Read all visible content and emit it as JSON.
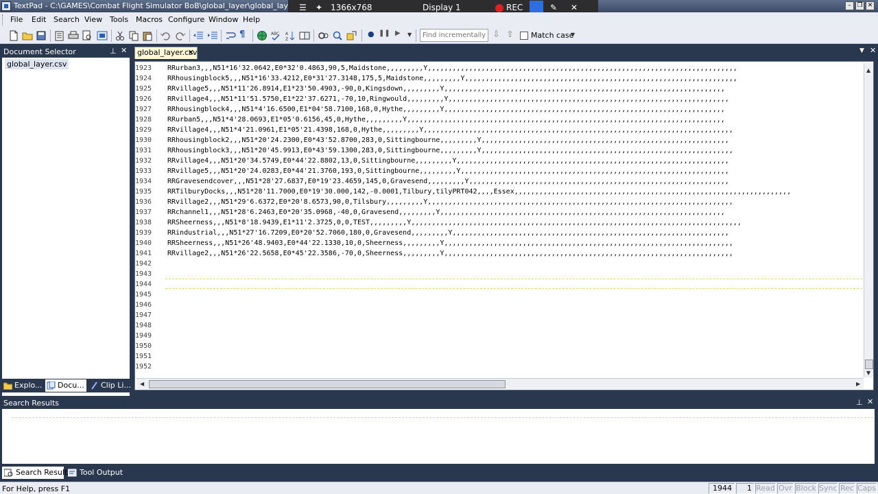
{
  "window": {
    "title": "TextPad - C:\\GAMES\\Combat Flight Simulator BoB\\global_layer\\global_layer.csv"
  },
  "recorder": {
    "resolution": "1366x768",
    "display": "Display 1",
    "rec_label": "REC"
  },
  "menu": [
    "File",
    "Edit",
    "Search",
    "View",
    "Tools",
    "Macros",
    "Configure",
    "Window",
    "Help"
  ],
  "toolbar": {
    "find_placeholder": "Find incrementally",
    "match_case_label": "Match case",
    "match_case_checked": false
  },
  "doc_selector": {
    "title": "Document Selector",
    "files": [
      "global_layer.csv"
    ],
    "tabs": [
      "Explo...",
      "Docu...",
      "Clip Li..."
    ],
    "active_tab": "Docu..."
  },
  "editor": {
    "tab_label": "global_layer.csv",
    "lines": [
      {
        "n": "1923",
        "text": "RRurban3,,,N51*16'32.0642,E0*32'0.4863,90,5,Maidstone,,,,,,,,,Y,,,,,,,,,,,,,,,,,,,,,,,,,,,,,,,,,,,,,,,,,,,,,,,,,,,,,,,,,,,,,,,,,,,,,,,,,,,"
      },
      {
        "n": "1924",
        "text": "RRhousingblock5,,,N51*16'33.4212,E0*31'27.3148,175,5,Maidstone,,,,,,,,,Y,,,,,,,,,,,,,,,,,,,,,,,,,,,,,,,,,,,,,,,,,,,,,,,,,,,,,,,,,,,,,,,,,,"
      },
      {
        "n": "1925",
        "text": "RRvillage5,,,N51*11'26.8914,E1*23'50.4903,-90,0,Kingsdown,,,,,,,,,Y,,,,,,,,,,,,,,,,,,,,,,,,,,,,,,,,,,,,,,,,,,,,,,,,,,,,,,,,,,,,,,,,,,,,"
      },
      {
        "n": "1926",
        "text": "RRvillage4,,,N51*11'51.5750,E1*22'37.6271,-70,10,Ringwould,,,,,,,,,Y,,,,,,,,,,,,,,,,,,,,,,,,,,,,,,,,,,,,,,,,,,,,,,,,,,,,,,,,,,,,,,,,,,,,"
      },
      {
        "n": "1927",
        "text": "RRhousingblock4,,,N51*4'16.6500,E1*04'58.7100,168,0,Hythe,,,,,,,,,Y,,,,,,,,,,,,,,,,,,,,,,,,,,,,,,,,,,,,,,,,,,,,,,,,,,,,,,,,,,,,,,,,,,,,"
      },
      {
        "n": "1928",
        "text": "RRurban5,,,N51*4'28.0693,E1*05'0.6156,45,0,Hythe,,,,,,,,,Y,,,,,,,,,,,,,,,,,,,,,,,,,,,,,,,,,,,,,,,,,,,,,,,,,,,,,,,,,,,,,,,,,,,,,,,,,,,,,"
      },
      {
        "n": "1929",
        "text": "RRvillage4,,,N51*4'21.0961,E1*05'21.4398,168,0,Hythe,,,,,,,,,Y,,,,,,,,,,,,,,,,,,,,,,,,,,,,,,,,,,,,,,,,,,,,,,,,,,,,,,,,,,,,,,,,,,,,,,,,,,,"
      },
      {
        "n": "1930",
        "text": "RRhousingblock2,,,N51*20'24.2300,E0*43'52.8700,283,0,Sittingbourne,,,,,,,,,Y,,,,,,,,,,,,,,,,,,,,,,,,,,,,,,,,,,,,,,,,,,,,,,,,,,,,,,,,,,,,"
      },
      {
        "n": "1931",
        "text": "RRhousingblock3,,,N51*20'45.9913,E0*43'59.1300,283,0,Sittingbourne,,,,,,,,,Y,,,,,,,,,,,,,,,,,,,,,,,,,,,,,,,,,,,,,,,,,,,,,,,,,,,,,,,,,,,,,"
      },
      {
        "n": "1932",
        "text": "RRvillage4,,,N51*20'34.5749,E0*44'22.8802,13,0,Sittingbourne,,,,,,,,,Y,,,,,,,,,,,,,,,,,,,,,,,,,,,,,,,,,,,,,,,,,,,,,,,,,,,,,,,,,,,,,,,,,,"
      },
      {
        "n": "1933",
        "text": "RRvillage5,,,N51*20'24.0283,E0*44'21.3760,193,0,Sittingbourne,,,,,,,,,Y,,,,,,,,,,,,,,,,,,,,,,,,,,,,,,,,,,,,,,,,,,,,,,,,,,,,,,,,,,,,,,,,,"
      },
      {
        "n": "1934",
        "text": "RRGravesendcover,,,N51*28'27.6837,E0*19'23.4659,145,0,Gravesend,,,,,,,,,Y,,,,,,,,,,,,,,,,,,,,,,,,,,,,,,,,,,,,,,,,,,,,,,,,,,,,,,,,,,,,,,,"
      },
      {
        "n": "1935",
        "text": "RRTilburyDocks,,,N51*28'11.7000,E0*19'30.000,142,-0.0001,Tilbury,tilyPRT042,,,,Essex,,,,,,,,,,,,,,,,,,,,,,,,,,,,,,,,,,,,,,,,,,,,,,,,,,,,,,,,,,,,,,,,,,,"
      },
      {
        "n": "1936",
        "text": "RRvillage2,,,N51*29'6.6372,E0*20'8.6573,90,0,Tilsbury,,,,,,,,,Y,,,,,,,,,,,,,,,,,,,,,,,,,,,,,,,,,,,,,,,,,,,,,,,,,,,,,,,,,,,,,,,,,,,,,,,,,,"
      },
      {
        "n": "1937",
        "text": "RRchannel1,,,N51*28'6.2463,E0*20'35.0968,-40,0,Gravesend,,,,,,,,,Y,,,,,,,,,,,,,,,,,,,,,,,,,,,,,,,,,,,,,,,,,,,,,,,,,,,,,,,,,,,,,,,,,,,,,"
      },
      {
        "n": "1938",
        "text": "RRSheerness,,,N51*8'18.9439,E1*11'2.3725,0,0,TEST,,,,,,,,,Y,,,,,,,,,,,,,,,,,,,,,,,,,,,,,,,,,,,,,,,,,,,,,,,,,,,,,,,,,,,,,,,,,,,,,,,,,,,,,,,,"
      },
      {
        "n": "1939",
        "text": "RRindustrial,,,N51*27'16.7209,E0*20'52.7060,180,0,Gravesend,,,,,,,,,Y,,,,,,,,,,,,,,,,,,,,,,,,,,,,,,,,,,,,,,,,,,,,,,,,,,,,,,,,,,,,,,,,,,,"
      },
      {
        "n": "1940",
        "text": "RRSheerness,,,N51*26'48.9403,E0*44'22.1330,10,0,Sheerness,,,,,,,,,Y,,,,,,,,,,,,,,,,,,,,,,,,,,,,,,,,,,,,,,,,,,,,,,,,,,,,,,,,,,,,,,,,,,,,,,"
      },
      {
        "n": "1941",
        "text": "RRvillage2,,,N51*26'22.5658,E0*45'22.3586,-70,0,Sheerness,,,,,,,,,Y,,,,,,,,,,,,,,,,,,,,,,,,,,,,,,,,,,,,,,,,,,,,,,,,,,,,,,,,,,,,,,,,,,,,,,"
      },
      {
        "n": "1942",
        "text": ""
      },
      {
        "n": "1943",
        "text": ""
      },
      {
        "n": "1944",
        "text": ""
      },
      {
        "n": "1945",
        "text": ""
      },
      {
        "n": "1946",
        "text": ""
      },
      {
        "n": "1947",
        "text": ""
      },
      {
        "n": "1948",
        "text": ""
      },
      {
        "n": "1949",
        "text": ""
      },
      {
        "n": "1950",
        "text": ""
      },
      {
        "n": "1951",
        "text": ""
      },
      {
        "n": "1952",
        "text": ""
      }
    ]
  },
  "search_results": {
    "title": "Search Results",
    "tabs": [
      "Search Results",
      "Tool Output"
    ],
    "active_tab": "Search Results"
  },
  "status": {
    "help_text": "For Help, press F1",
    "line": "1944",
    "column": "1",
    "indicators": [
      "Read",
      "Ovr",
      "Block",
      "Sync",
      "Rec",
      "Caps"
    ]
  },
  "colors": {
    "panel_bg": "#29374f",
    "chrome_bg": "#e9ecf2",
    "tab_bg": "#fff7d6",
    "rec_dot": "#e02020"
  }
}
